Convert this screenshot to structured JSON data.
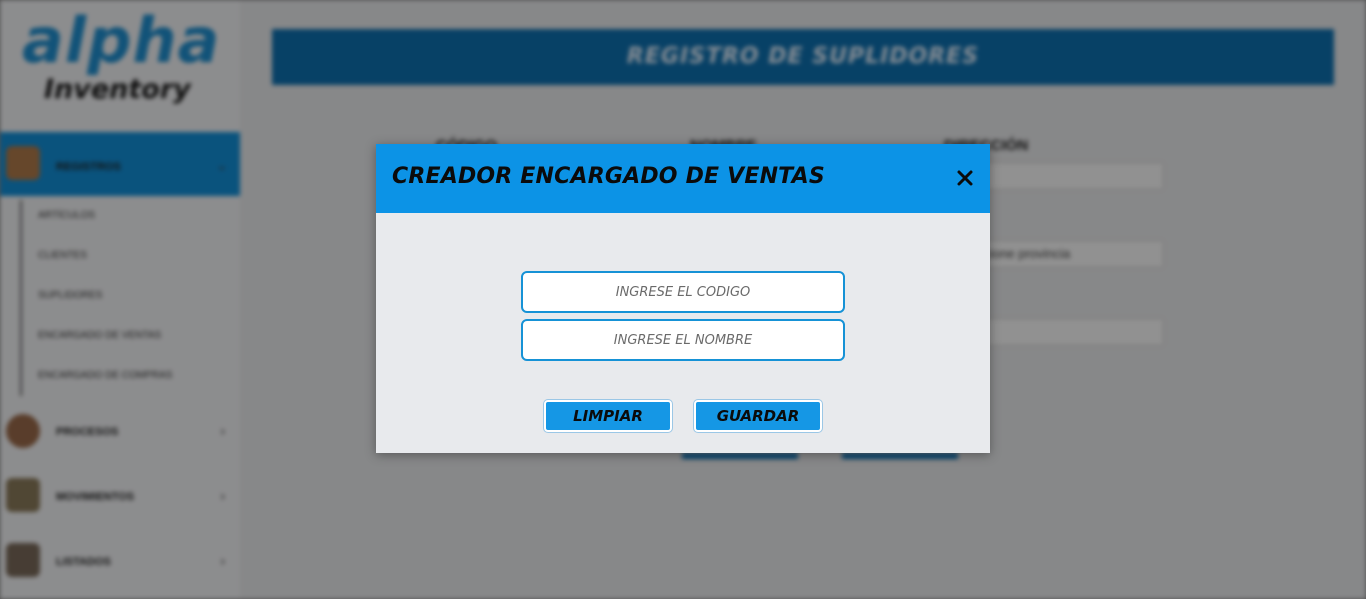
{
  "app": {
    "logo_main": "alpha",
    "logo_sub": "Inventory"
  },
  "sidebar": {
    "items": [
      {
        "label": "REGISTROS",
        "icon": "registers-icon"
      },
      {
        "label": "PROCESOS",
        "icon": "processes-icon"
      },
      {
        "label": "MOVIMIENTOS",
        "icon": "movements-icon"
      },
      {
        "label": "LISTADOS",
        "icon": "listings-icon"
      }
    ],
    "subitems": [
      "ARTÍCULOS",
      "CLIENTES",
      "SUPLIDORES",
      "ENCARGADO DE VENTAS",
      "ENCARGADO DE COMPRAS"
    ]
  },
  "main": {
    "title": "REGISTRO DE SUPLIDORES",
    "labels": [
      "CÓDIGO",
      "NOMBRE",
      "DIRECCIÓN"
    ],
    "province_placeholder": "Seleccione provincia",
    "accent_color": "#0d70b0"
  },
  "modal": {
    "title": "CREADOR ENCARGADO DE VENTAS",
    "close_symbol": "×",
    "code_placeholder": "INGRESE EL CÓDIGO",
    "name_placeholder": "INGRESE EL NOMBRE",
    "clear_label": "LIMPIAR",
    "save_label": "GUARDAR",
    "header_color": "#0c93e6"
  }
}
